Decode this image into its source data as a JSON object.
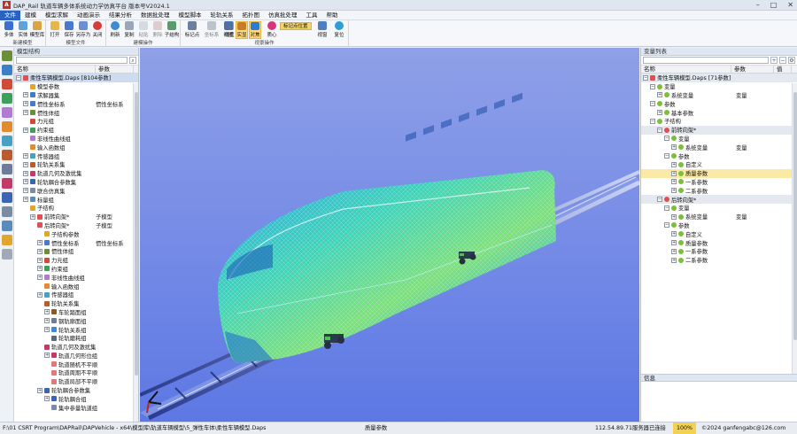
{
  "titlebar": {
    "title": "DAP_Rail 轨道车辆多体系统动力学仿真平台 版本号V2024.1"
  },
  "menu": [
    "文件",
    "建模",
    "模型求解",
    "动画演示",
    "结果分析",
    "数据批处理",
    "模型脚本",
    "轮轨关系",
    "拓扑图",
    "仿真批处理",
    "工具",
    "帮助"
  ],
  "ribbon": {
    "groups": [
      {
        "label": "新建模型",
        "buttons": [
          "多体",
          "实体",
          "模型库"
        ]
      },
      {
        "label": "模型文件",
        "buttons": [
          "打开",
          "保存",
          "另存为",
          "关闭"
        ]
      },
      {
        "label": "建模操作",
        "buttons": [
          "刷新",
          "复制",
          "粘贴",
          "删除",
          "子结构"
        ]
      },
      {
        "label": "视景操作",
        "buttons": [
          "标记点",
          "坐标系",
          "线框",
          "视图",
          "实显",
          "对焦",
          "质心",
          "标记点位置",
          "视窗",
          "复位"
        ]
      }
    ]
  },
  "left_panel": {
    "title": "模型结构",
    "col_name": "名称",
    "col_param": "参数",
    "root": "柔性车辆模型.Daps [8104参数]",
    "rows": [
      {
        "label": "模型参数",
        "param": ""
      },
      {
        "label": "求解器集",
        "param": ""
      },
      {
        "label": "惯性坐标系",
        "param": "惯性坐标系"
      },
      {
        "label": "惯性体组",
        "param": ""
      },
      {
        "label": "力元组",
        "param": ""
      },
      {
        "label": "约束组",
        "param": ""
      },
      {
        "label": "非线性曲线组",
        "param": ""
      },
      {
        "label": "输入函数组",
        "param": ""
      },
      {
        "label": "传感器组",
        "param": ""
      },
      {
        "label": "轮轨关系集",
        "param": ""
      },
      {
        "label": "轨道几何及激扰集",
        "param": ""
      },
      {
        "label": "轮轨耦合参数集",
        "param": ""
      },
      {
        "label": "联合仿真集",
        "param": ""
      },
      {
        "label": "标量组",
        "param": ""
      },
      {
        "label": "子结构",
        "param": ""
      },
      {
        "label": "前转向架*",
        "param": "子模型"
      },
      {
        "label": "后转向架*",
        "param": "子模型"
      },
      {
        "label": "子结构参数",
        "param": ""
      },
      {
        "label": "惯性坐标系",
        "param": "惯性坐标系"
      },
      {
        "label": "惯性体组",
        "param": ""
      },
      {
        "label": "力元组",
        "param": ""
      },
      {
        "label": "约束组",
        "param": ""
      },
      {
        "label": "非线性曲线组",
        "param": ""
      },
      {
        "label": "输入函数组",
        "param": ""
      },
      {
        "label": "传感器组",
        "param": ""
      },
      {
        "label": "轮轨关系集",
        "param": ""
      },
      {
        "label": "车轮踏面组",
        "param": ""
      },
      {
        "label": "钢轨廓面组",
        "param": ""
      },
      {
        "label": "轮轨关系组",
        "param": ""
      },
      {
        "label": "轮轨磨耗组",
        "param": ""
      },
      {
        "label": "轨道几何及激扰集",
        "param": ""
      },
      {
        "label": "轨道几何形位组",
        "param": ""
      },
      {
        "label": "轨道随机不平顺",
        "param": ""
      },
      {
        "label": "轨道周期不平顺",
        "param": ""
      },
      {
        "label": "轨道局部不平顺",
        "param": ""
      },
      {
        "label": "轮轨耦合参数集",
        "param": ""
      },
      {
        "label": "轮轨耦合组",
        "param": ""
      },
      {
        "label": "集中参量轨道组",
        "param": ""
      }
    ]
  },
  "right_panel": {
    "title": "变量列表",
    "col_name": "名称",
    "col_param": "参数",
    "col_val": "值",
    "root": "柔性车辆模型.Daps [71参数]",
    "rows": [
      {
        "label": "变量",
        "val": ""
      },
      {
        "label": "系统变量",
        "val": "变量"
      },
      {
        "label": "参数",
        "val": ""
      },
      {
        "label": "基本参数",
        "val": ""
      },
      {
        "label": "子结构",
        "val": ""
      },
      {
        "label": "前转向架*",
        "val": ""
      },
      {
        "label": "变量",
        "val": ""
      },
      {
        "label": "系统变量",
        "val": "变量"
      },
      {
        "label": "参数",
        "val": ""
      },
      {
        "label": "自定义",
        "val": ""
      },
      {
        "label": "质量参数",
        "val": ""
      },
      {
        "label": "一系参数",
        "val": ""
      },
      {
        "label": "二系参数",
        "val": ""
      },
      {
        "label": "后转向架*",
        "val": ""
      },
      {
        "label": "变量",
        "val": ""
      },
      {
        "label": "系统变量",
        "val": "变量"
      },
      {
        "label": "参数",
        "val": ""
      },
      {
        "label": "自定义",
        "val": ""
      },
      {
        "label": "质量参数",
        "val": ""
      },
      {
        "label": "一系参数",
        "val": ""
      },
      {
        "label": "二系参数",
        "val": ""
      }
    ],
    "info_title": "信息"
  },
  "statusbar": {
    "path": "F:\\01 CSRT Program\\DAPRail\\DAPVehicle - x64\\模型库\\轨道车辆模型\\5_弹性车体\\柔性车辆模型.Daps",
    "center": "质量参数",
    "server": "112.54.89.71服务器已连接",
    "zoom": "100%",
    "copyright": "©2024 ganfengabc@126.com"
  }
}
